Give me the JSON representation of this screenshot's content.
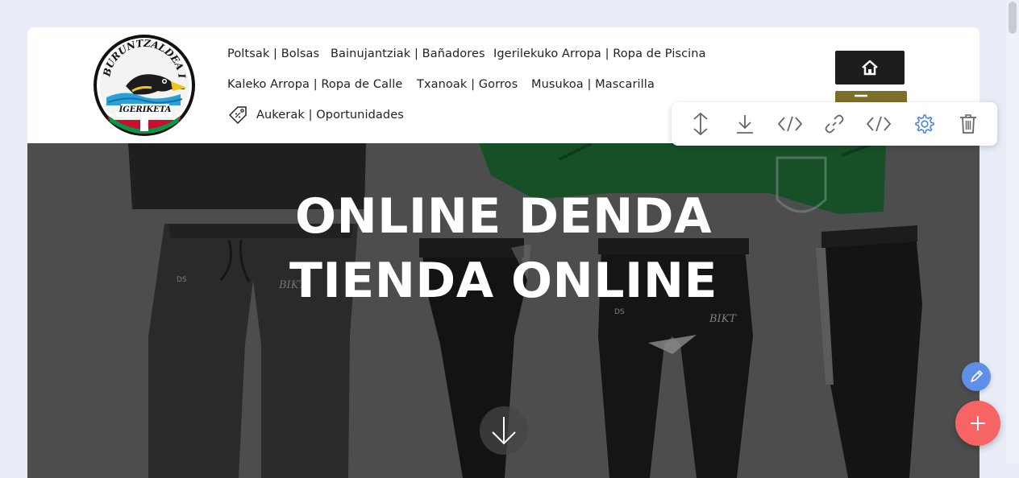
{
  "brand": {
    "logo_top_text": "BURUNTZALDEA IKT",
    "logo_bottom_text": "IGERIKETA"
  },
  "nav": {
    "items": [
      {
        "label": "Poltsak | Bolsas"
      },
      {
        "label": "Bainujantziak | Bañadores"
      },
      {
        "label": "Igerilekuko Arropa | Ropa de Piscina"
      },
      {
        "label": "Kaleko Arropa | Ropa de Calle"
      },
      {
        "label": "Txanoak | Gorros"
      },
      {
        "label": "Musukoa | Mascarilla"
      },
      {
        "label": "Aukerak | Oportunidades"
      }
    ]
  },
  "hero": {
    "title_line1": "ONLINE DENDA",
    "title_line2": "TIENDA ONLINE",
    "garment_print_1": "BIKT",
    "garment_print_2": "BIKT"
  },
  "toolbar": {
    "icons": [
      "move-vertical-icon",
      "download-icon",
      "code-icon",
      "link-icon",
      "code-icon",
      "gear-icon",
      "trash-icon"
    ],
    "active_color": "#4a86e8"
  },
  "colors": {
    "home_button": "#1d1d1d",
    "cart_button": "#7c7028",
    "fab_add": "#f76464",
    "fab_edit": "#5f8fe6",
    "page_bg": "#e8ecf7"
  }
}
